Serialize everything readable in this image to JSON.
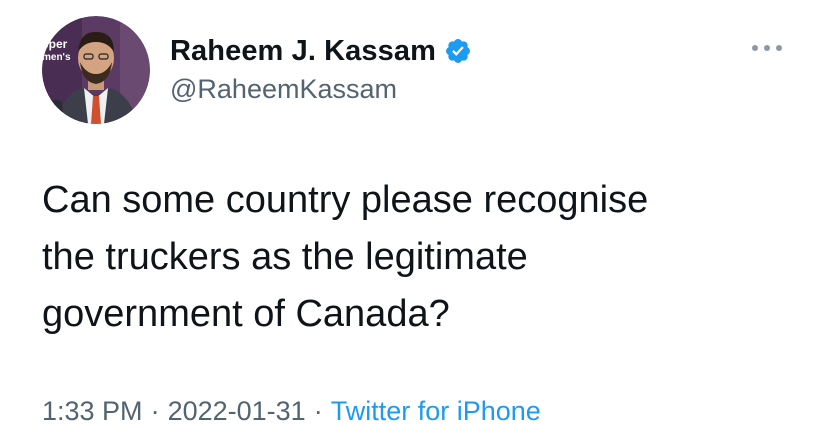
{
  "tweet": {
    "avatar": {
      "alt": "profile photo",
      "background_text_line1": "eper",
      "background_text_line2": "men's"
    },
    "display_name": "Raheem J. Kassam",
    "handle": "@RaheemKassam",
    "verified_icon": "verified-badge-icon",
    "more_icon": "more-options-icon",
    "text_lines": [
      "Can some country please recognise",
      "the truckers as the legitimate",
      "government of Canada?"
    ],
    "time": "1:33 PM",
    "separator1": "·",
    "date": "2022-01-31",
    "separator2": "·",
    "source": "Twitter for iPhone"
  },
  "colors": {
    "text_primary": "#0f1419",
    "text_secondary": "#536471",
    "accent": "#1d9bf0"
  }
}
